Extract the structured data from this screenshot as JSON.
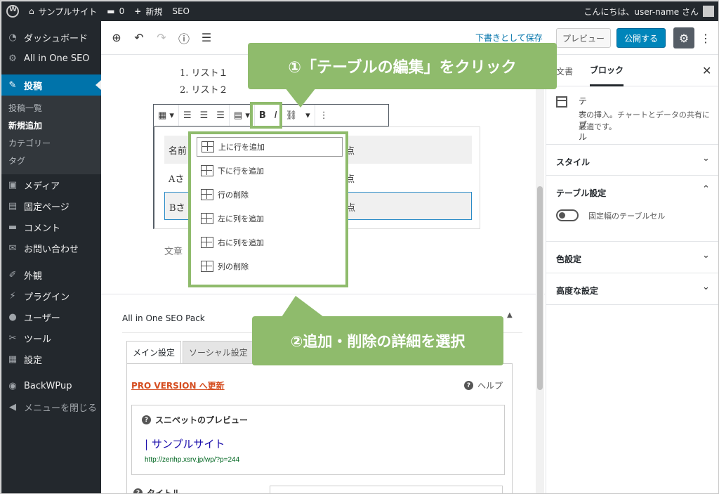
{
  "adminbar": {
    "site_name": "サンプルサイト",
    "comments_count": "0",
    "new_label": "新規",
    "seo_label": "SEO",
    "greeting": "こんにちは、user-name さん"
  },
  "sidebar": {
    "items": [
      {
        "icon": "dashboard-icon",
        "glyph": "◔",
        "label": "ダッシュボード"
      },
      {
        "icon": "gear-icon",
        "glyph": "⚙",
        "label": "All in One SEO"
      },
      {
        "icon": "pin-icon",
        "glyph": "✎",
        "label": "投稿"
      },
      {
        "icon": "media-icon",
        "glyph": "▣",
        "label": "メディア"
      },
      {
        "icon": "page-icon",
        "glyph": "▤",
        "label": "固定ページ"
      },
      {
        "icon": "comment-icon",
        "glyph": "▬",
        "label": "コメント"
      },
      {
        "icon": "mail-icon",
        "glyph": "✉",
        "label": "お問い合わせ"
      },
      {
        "icon": "appearance-icon",
        "glyph": "✐",
        "label": "外観"
      },
      {
        "icon": "plugin-icon",
        "glyph": "⚡",
        "label": "プラグイン"
      },
      {
        "icon": "user-icon",
        "glyph": "●",
        "label": "ユーザー"
      },
      {
        "icon": "tools-icon",
        "glyph": "✂",
        "label": "ツール"
      },
      {
        "icon": "settings-icon",
        "glyph": "▦",
        "label": "設定"
      },
      {
        "icon": "backwpup-icon",
        "glyph": "◉",
        "label": "BackWPup"
      },
      {
        "icon": "collapse-icon",
        "glyph": "◀",
        "label": "メニューを閉じる"
      }
    ],
    "submenu": [
      "投稿一覧",
      "新規追加",
      "カテゴリー",
      "タグ"
    ]
  },
  "toolbar": {
    "draft_label": "下書きとして保存",
    "preview_label": "プレビュー",
    "publish_label": "公開する"
  },
  "editor": {
    "list_items": [
      "リスト１",
      "リスト２"
    ],
    "table_rows": [
      {
        "a": "名前",
        "b": "点"
      },
      {
        "a": "Aさ",
        "b": "点"
      },
      {
        "a": "Bさ",
        "b": "点"
      }
    ],
    "row_first_tail": "点",
    "placeholder": "文章",
    "dropdown": [
      "上に行を追加",
      "下に行を追加",
      "行の削除",
      "左に列を追加",
      "右に列を追加",
      "列の削除"
    ]
  },
  "seo": {
    "title": "All in One SEO Pack",
    "tab_main": "メイン設定",
    "tab_social": "ソーシャル設定",
    "pro_link": "PRO VERSION へ更新",
    "help": "ヘルプ",
    "snippet_heading": "スニペットのプレビュー",
    "snippet_title": "| サンプルサイト",
    "snippet_url": "http://zenhp.xsrv.jp/wp/?p=244",
    "title_label": "タイトル"
  },
  "settings": {
    "tab_document": "文書",
    "tab_block": "ブロック",
    "block_name": "テーブル",
    "block_desc": "表の挿入。チャートとデータの共有に最適です。",
    "panel_style": "スタイル",
    "panel_table": "テーブル設定",
    "toggle_label": "固定幅のテーブルセル",
    "panel_color": "色設定",
    "panel_advanced": "高度な設定"
  },
  "callouts": {
    "step1": "①「テーブルの編集」をクリック",
    "step2": "②追加・削除の詳細を選択"
  },
  "colors": {
    "admin_bg": "#23282d",
    "accent": "#0073aa",
    "callout": "#8fbb6c"
  }
}
